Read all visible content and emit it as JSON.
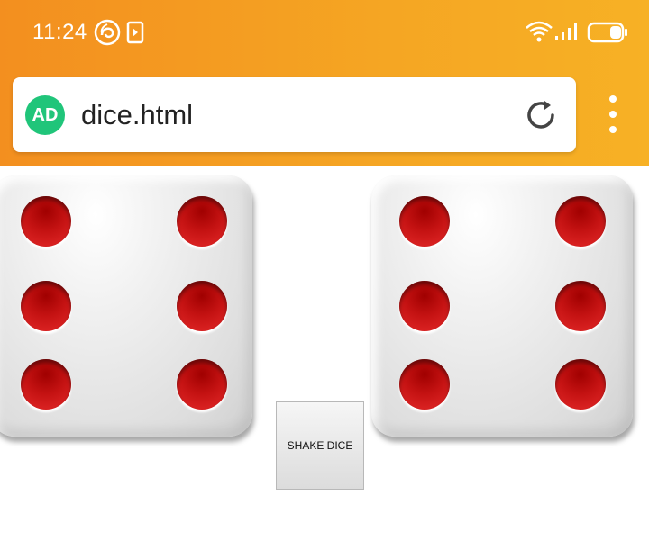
{
  "status_bar": {
    "time": "11:24",
    "icons": [
      "app-notification-icon",
      "media-notification-icon",
      "wifi-icon",
      "signal-icon",
      "battery-icon"
    ]
  },
  "browser": {
    "url": "dice.html",
    "badge_text": "AD",
    "accent_color": "#f5a623",
    "badge_color": "#20c57a"
  },
  "dice": {
    "left": {
      "value": 6
    },
    "right": {
      "value": 6
    },
    "pip_color": "#d01a1a"
  },
  "shake_button": {
    "label": "SHAKE DICE"
  }
}
